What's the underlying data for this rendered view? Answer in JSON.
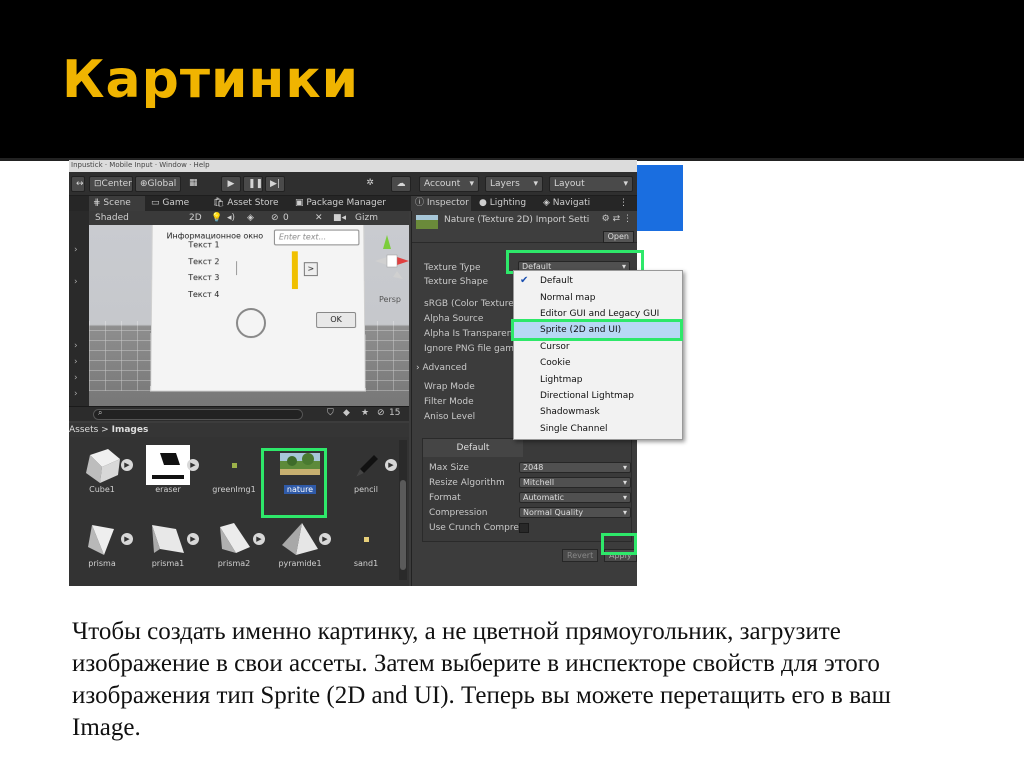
{
  "slide": {
    "title": "Картинки",
    "caption": "Чтобы создать именно картинку, а не цветной прямоугольник, загрузите изображение в свои ассеты. Затем выберите в инспекторе свойств для этого изображения тип Sprite (2D and UI). Теперь вы можете перетащить его в ваш Image."
  },
  "menu": {
    "text": "Inpustick · Mobile Input · Window · Help"
  },
  "toolbar": {
    "center": "Center",
    "global": "Global",
    "account": "Account",
    "layers": "Layers",
    "layout": "Layout"
  },
  "tabs": {
    "scene": "Scene",
    "game": "Game",
    "asset_store": "Asset Store",
    "package_manager": "Package Manager",
    "inspector": "Inspector",
    "lighting": "Lighting",
    "navigation": "Navigati"
  },
  "scene_bar": {
    "shaded": "Shaded",
    "mode_2d": "2D",
    "gizmos": "Gizm",
    "count": "0"
  },
  "viewport": {
    "panel_title": "Информационное окно",
    "input_placeholder": "Enter text...",
    "items": [
      "Текст 1",
      "Текст 2",
      "Текст 3",
      "Текст 4"
    ],
    "arrow_button": ">",
    "ok_button": "OK",
    "persp": "Persp"
  },
  "project": {
    "breadcrumb_root": "Assets",
    "breadcrumb_sep": ">",
    "breadcrumb_folder": "Images",
    "hidden_count": "15",
    "assets": [
      {
        "name": "Cube1"
      },
      {
        "name": "eraser"
      },
      {
        "name": "greenImg1"
      },
      {
        "name": "nature"
      },
      {
        "name": "pencil"
      },
      {
        "name": "prisma"
      },
      {
        "name": "prisma1"
      },
      {
        "name": "prisma2"
      },
      {
        "name": "pyramide1"
      },
      {
        "name": "sand1"
      }
    ]
  },
  "inspector": {
    "title": "Nature (Texture 2D) Import Setti",
    "open": "Open",
    "rows": {
      "texture_type": "Texture Type",
      "texture_shape": "Texture Shape",
      "srgb": "sRGB (Color Texture)",
      "alpha_source": "Alpha Source",
      "alpha_transparency": "Alpha Is Transparenc",
      "ignore_png": "Ignore PNG file gamm",
      "advanced": "Advanced",
      "wrap_mode": "Wrap Mode",
      "filter_mode": "Filter Mode",
      "aniso_level": "Aniso Level"
    },
    "texture_type_value": "Default",
    "platform": {
      "tab": "Default",
      "max_size_label": "Max Size",
      "max_size_value": "2048",
      "resize_label": "Resize Algorithm",
      "resize_value": "Mitchell",
      "format_label": "Format",
      "format_value": "Automatic",
      "compression_label": "Compression",
      "compression_value": "Normal Quality",
      "crunch_label": "Use Crunch Compres"
    },
    "revert": "Revert",
    "apply": "Apply"
  },
  "dropdown": {
    "items": [
      "Default",
      "Normal map",
      "Editor GUI and Legacy GUI",
      "Sprite (2D and UI)",
      "Cursor",
      "Cookie",
      "Lightmap",
      "Directional Lightmap",
      "Shadowmask",
      "Single Channel"
    ],
    "checked": "Default",
    "highlighted": "Sprite (2D and UI)"
  },
  "colors": {
    "title": "#f0b400",
    "highlight_green": "#2ee86a",
    "unity_bg": "#3c3c3c"
  }
}
